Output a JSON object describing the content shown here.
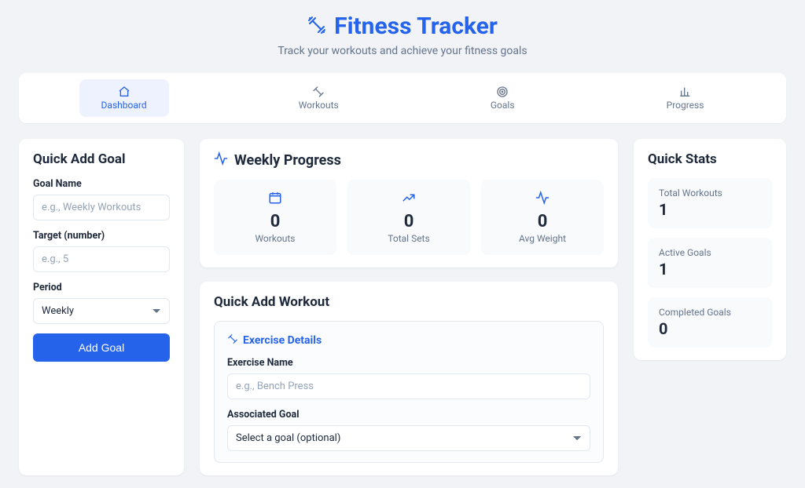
{
  "header": {
    "title": "Fitness Tracker",
    "subtitle": "Track your workouts and achieve your fitness goals"
  },
  "tabs": {
    "dashboard": "Dashboard",
    "workouts": "Workouts",
    "goals": "Goals",
    "progress": "Progress"
  },
  "quickAddGoal": {
    "title": "Quick Add Goal",
    "goalNameLabel": "Goal Name",
    "goalNamePlaceholder": "e.g., Weekly Workouts",
    "targetLabel": "Target (number)",
    "targetPlaceholder": "e.g., 5",
    "periodLabel": "Period",
    "periodValue": "Weekly",
    "addButton": "Add Goal"
  },
  "weeklyProgress": {
    "title": "Weekly Progress",
    "tiles": {
      "workouts": {
        "value": "0",
        "label": "Workouts"
      },
      "totalSets": {
        "value": "0",
        "label": "Total Sets"
      },
      "avgWeight": {
        "value": "0",
        "label": "Avg Weight"
      }
    }
  },
  "quickAddWorkout": {
    "title": "Quick Add Workout",
    "exerciseDetailsLegend": "Exercise Details",
    "exerciseNameLabel": "Exercise Name",
    "exerciseNamePlaceholder": "e.g., Bench Press",
    "associatedGoalLabel": "Associated Goal",
    "associatedGoalPlaceholder": "Select a goal (optional)"
  },
  "quickStats": {
    "title": "Quick Stats",
    "totalWorkouts": {
      "label": "Total Workouts",
      "value": "1"
    },
    "activeGoals": {
      "label": "Active Goals",
      "value": "1"
    },
    "completedGoals": {
      "label": "Completed Goals",
      "value": "0"
    }
  },
  "colors": {
    "accent": "#2563eb"
  }
}
